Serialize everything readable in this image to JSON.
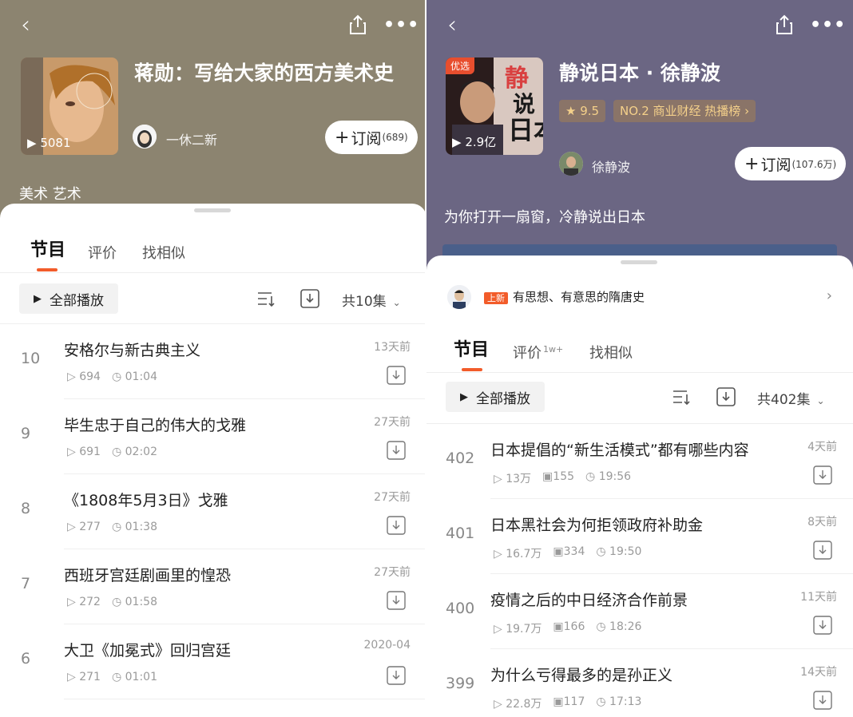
{
  "left": {
    "album_title": "蒋勋：写给大家的西方美术史",
    "cover_plays": "5081",
    "author": "一休二新",
    "subscribe_label": "订阅",
    "subscribe_count": "(689)",
    "tags": "美术 艺术",
    "tabs": [
      "节目",
      "评价",
      "找相似"
    ],
    "play_all": "全部播放",
    "episodes_total": "共10集",
    "items": [
      {
        "num": "10",
        "title": "安格尔与新古典主义",
        "plays": "694",
        "duration": "01:04",
        "date": "13天前"
      },
      {
        "num": "9",
        "title": "毕生忠于自己的伟大的戈雅",
        "plays": "691",
        "duration": "02:02",
        "date": "27天前"
      },
      {
        "num": "8",
        "title": "《1808年5月3日》戈雅",
        "plays": "277",
        "duration": "01:38",
        "date": "27天前"
      },
      {
        "num": "7",
        "title": "西班牙宫廷剧画里的惶恐",
        "plays": "272",
        "duration": "01:58",
        "date": "27天前"
      },
      {
        "num": "6",
        "title": "大卫《加冕式》回归宫廷",
        "plays": "271",
        "duration": "01:01",
        "date": "2020-04"
      }
    ]
  },
  "right": {
    "album_title": "静说日本 · 徐静波",
    "cover_badge": "优选",
    "cover_plays": "2.9亿",
    "rating": "9.5",
    "rank": "NO.2 商业财经 热播榜",
    "author": "徐静波",
    "subscribe_label": "订阅",
    "subscribe_count": "(107.6万)",
    "tagline": "为你打开一扇窗，冷静说出日本",
    "new_tag": "上新",
    "new_title": "有思想、有意思的隋唐史",
    "tabs": [
      "节目",
      "评价",
      "找相似"
    ],
    "review_count": "1w+",
    "play_all": "全部播放",
    "episodes_total": "共402集",
    "items": [
      {
        "num": "402",
        "title": "日本提倡的“新生活模式”都有哪些内容",
        "plays": "13万",
        "comments": "155",
        "duration": "19:56",
        "date": "4天前"
      },
      {
        "num": "401",
        "title": "日本黑社会为何拒领政府补助金",
        "plays": "16.7万",
        "comments": "334",
        "duration": "19:50",
        "date": "8天前"
      },
      {
        "num": "400",
        "title": "疫情之后的中日经济合作前景",
        "plays": "19.7万",
        "comments": "166",
        "duration": "18:26",
        "date": "11天前"
      },
      {
        "num": "399",
        "title": "为什么亏得最多的是孙正义",
        "plays": "22.8万",
        "comments": "117",
        "duration": "17:13",
        "date": "14天前"
      }
    ]
  }
}
